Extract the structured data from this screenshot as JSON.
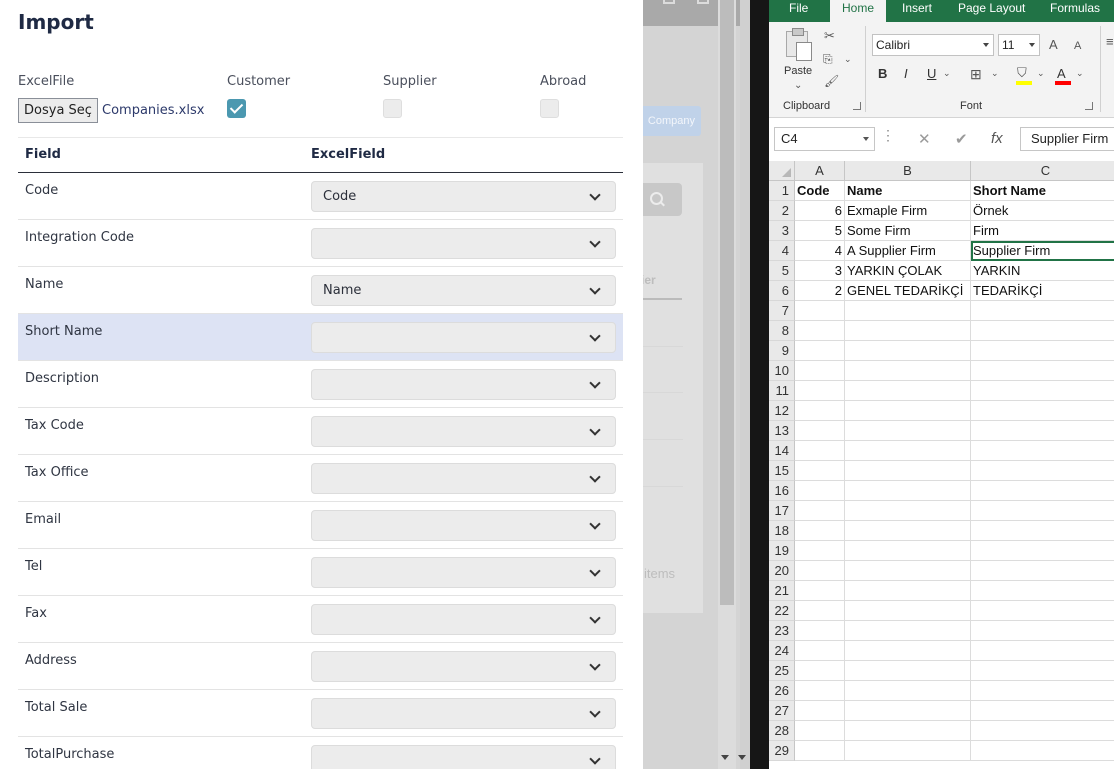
{
  "modal": {
    "title": "Import",
    "options": {
      "excel_file_label": "ExcelFile",
      "file_button": "Dosya Seç",
      "file_name": "Companies.xlsx",
      "customer_label": "Customer",
      "customer_checked": true,
      "supplier_label": "Supplier",
      "supplier_checked": false,
      "abroad_label": "Abroad",
      "abroad_checked": false
    },
    "table": {
      "headers": [
        "Field",
        "ExcelField"
      ],
      "rows": [
        {
          "field": "Code",
          "excel_field": "Code"
        },
        {
          "field": "Integration Code",
          "excel_field": ""
        },
        {
          "field": "Name",
          "excel_field": "Name"
        },
        {
          "field": "Short Name",
          "excel_field": "",
          "highlighted": true
        },
        {
          "field": "Description",
          "excel_field": ""
        },
        {
          "field": "Tax Code",
          "excel_field": ""
        },
        {
          "field": "Tax Office",
          "excel_field": ""
        },
        {
          "field": "Email",
          "excel_field": ""
        },
        {
          "field": "Tel",
          "excel_field": ""
        },
        {
          "field": "Fax",
          "excel_field": ""
        },
        {
          "field": "Address",
          "excel_field": ""
        },
        {
          "field": "Total Sale",
          "excel_field": ""
        },
        {
          "field": "TotalPurchase",
          "excel_field": ""
        }
      ]
    }
  },
  "background_page": {
    "button_text": "Company",
    "tab_text": "ier",
    "footer_text": "items"
  },
  "excel": {
    "tabs": [
      "File",
      "Home",
      "Insert",
      "Page Layout",
      "Formulas"
    ],
    "active_tab": "Home",
    "ribbon": {
      "clipboard_group": "Clipboard",
      "paste_label": "Paste",
      "font_group": "Font",
      "font_name": "Calibri",
      "font_size": "11",
      "bold": "B",
      "italic": "I",
      "underline": "U",
      "grow_font": "A",
      "shrink_font": "A",
      "font_color_letter": "A",
      "fill_color": "#ffff00",
      "font_color": "#ff0000"
    },
    "formula_bar": {
      "name_box": "C4",
      "cancel": "✕",
      "enter": "✔",
      "fx": "fx",
      "content": "Supplier Firm"
    },
    "columns": [
      "A",
      "B",
      "C"
    ],
    "rows": [
      {
        "n": "1",
        "a": "Code",
        "b": "Name",
        "c": "Short Name"
      },
      {
        "n": "2",
        "a": "6",
        "b": "Exmaple Firm",
        "c": "Örnek"
      },
      {
        "n": "3",
        "a": "5",
        "b": "Some Firm",
        "c": "Firm"
      },
      {
        "n": "4",
        "a": "4",
        "b": "A Supplier Firm",
        "c": "Supplier Firm"
      },
      {
        "n": "5",
        "a": "3",
        "b": "YARKIN ÇOLAK",
        "c": "YARKIN"
      },
      {
        "n": "6",
        "a": "2",
        "b": "GENEL TEDARİKÇİ",
        "c": "TEDARİKÇİ"
      },
      {
        "n": "7",
        "a": "",
        "b": "",
        "c": ""
      },
      {
        "n": "8",
        "a": "",
        "b": "",
        "c": ""
      },
      {
        "n": "9",
        "a": "",
        "b": "",
        "c": ""
      },
      {
        "n": "10",
        "a": "",
        "b": "",
        "c": ""
      },
      {
        "n": "11",
        "a": "",
        "b": "",
        "c": ""
      },
      {
        "n": "12",
        "a": "",
        "b": "",
        "c": ""
      },
      {
        "n": "13",
        "a": "",
        "b": "",
        "c": ""
      },
      {
        "n": "14",
        "a": "",
        "b": "",
        "c": ""
      },
      {
        "n": "15",
        "a": "",
        "b": "",
        "c": ""
      },
      {
        "n": "16",
        "a": "",
        "b": "",
        "c": ""
      },
      {
        "n": "17",
        "a": "",
        "b": "",
        "c": ""
      },
      {
        "n": "18",
        "a": "",
        "b": "",
        "c": ""
      },
      {
        "n": "19",
        "a": "",
        "b": "",
        "c": ""
      },
      {
        "n": "20",
        "a": "",
        "b": "",
        "c": ""
      },
      {
        "n": "21",
        "a": "",
        "b": "",
        "c": ""
      },
      {
        "n": "22",
        "a": "",
        "b": "",
        "c": ""
      },
      {
        "n": "23",
        "a": "",
        "b": "",
        "c": ""
      },
      {
        "n": "24",
        "a": "",
        "b": "",
        "c": ""
      },
      {
        "n": "25",
        "a": "",
        "b": "",
        "c": ""
      },
      {
        "n": "26",
        "a": "",
        "b": "",
        "c": ""
      },
      {
        "n": "27",
        "a": "",
        "b": "",
        "c": ""
      },
      {
        "n": "28",
        "a": "",
        "b": "",
        "c": ""
      },
      {
        "n": "29",
        "a": "",
        "b": "",
        "c": ""
      }
    ]
  }
}
